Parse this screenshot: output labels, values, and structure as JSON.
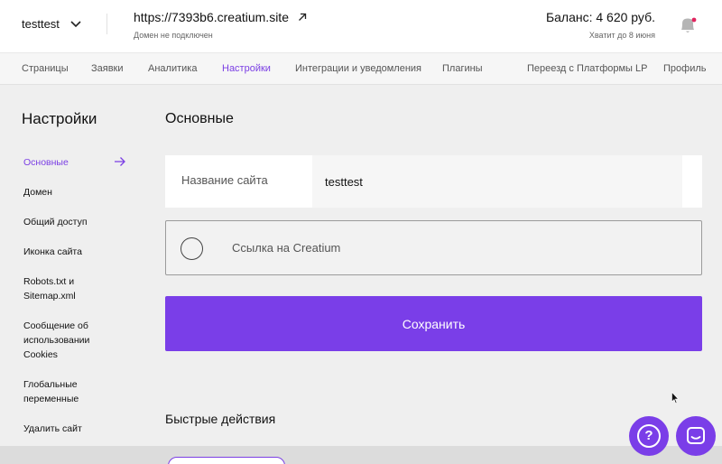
{
  "header": {
    "project_name": "testtest",
    "site_url": "https://7393b6.creatium.site",
    "domain_status": "Домен не подключен",
    "balance": "Баланс: 4 620 руб.",
    "balance_note": "Хватит до 8 июня"
  },
  "nav": {
    "items": [
      {
        "label": "Страницы"
      },
      {
        "label": "Заявки"
      },
      {
        "label": "Аналитика"
      },
      {
        "label": "Настройки"
      },
      {
        "label": "Интеграции и уведомления"
      },
      {
        "label": "Плагины"
      },
      {
        "label": "Переезд с Платформы LP"
      },
      {
        "label": "Профиль"
      }
    ],
    "active": "Настройки"
  },
  "sidebar": {
    "title": "Настройки",
    "items": [
      {
        "label": "Основные"
      },
      {
        "label": "Домен"
      },
      {
        "label": "Общий доступ"
      },
      {
        "label": "Иконка сайта"
      },
      {
        "label": "Robots.txt и Sitemap.xml"
      },
      {
        "label": "Сообщение об использовании Cookies"
      },
      {
        "label": "Глобальные переменные"
      },
      {
        "label": "Удалить сайт"
      }
    ],
    "active": "Основные"
  },
  "main": {
    "title": "Основные",
    "site_name_label": "Название сайта",
    "site_name_value": "testtest",
    "creatium_link_label": "Ссылка на Creatium",
    "save_label": "Сохранить",
    "quick_actions_title": "Быстрые действия"
  },
  "widgets": {
    "help_label": "?"
  },
  "colors": {
    "accent": "#7a3ee8",
    "notification_dot": "#e0245e"
  },
  "icons": {
    "project": "chevron-down-icon",
    "site": "external-link-arrow-icon",
    "notifications": "bell-icon",
    "sidebar_active": "arrow-right-icon",
    "help": "question-icon",
    "chat": "chat-icon"
  }
}
